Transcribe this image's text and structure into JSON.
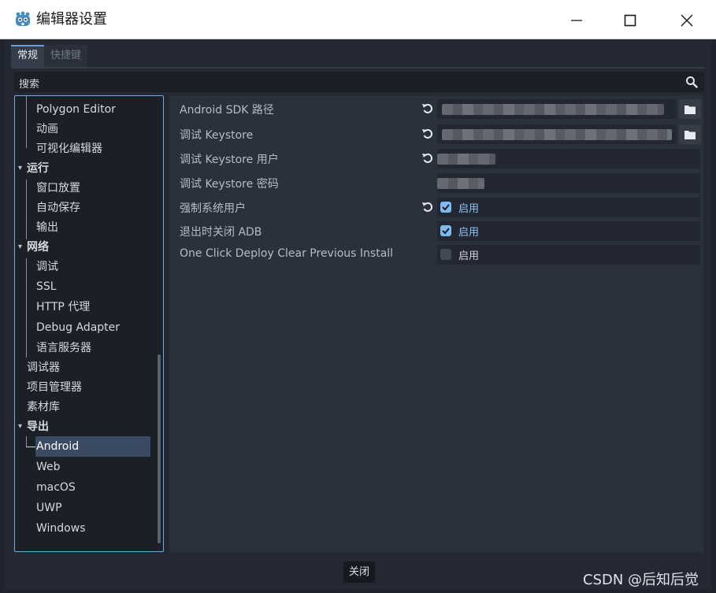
{
  "window": {
    "title": "编辑器设置",
    "icon": "godot-icon",
    "controls": [
      "minimize-icon",
      "maximize-icon",
      "close-icon"
    ]
  },
  "tabs": [
    {
      "label": "常规",
      "active": true
    },
    {
      "label": "快捷键",
      "active": false
    }
  ],
  "search": {
    "placeholder": "搜索",
    "icon": "search-icon"
  },
  "tree": {
    "items": [
      {
        "label": "Polygon Editor",
        "type": "item"
      },
      {
        "label": "动画",
        "type": "item"
      },
      {
        "label": "可视化编辑器",
        "type": "item"
      },
      {
        "label": "运行",
        "type": "category"
      },
      {
        "label": "窗口放置",
        "type": "item"
      },
      {
        "label": "自动保存",
        "type": "item"
      },
      {
        "label": "输出",
        "type": "item"
      },
      {
        "label": "网络",
        "type": "category"
      },
      {
        "label": "调试",
        "type": "item"
      },
      {
        "label": "SSL",
        "type": "item"
      },
      {
        "label": "HTTP 代理",
        "type": "item"
      },
      {
        "label": "Debug Adapter",
        "type": "item"
      },
      {
        "label": "语言服务器",
        "type": "item"
      },
      {
        "label": "调试器",
        "type": "top"
      },
      {
        "label": "项目管理器",
        "type": "top"
      },
      {
        "label": "素材库",
        "type": "top"
      },
      {
        "label": "导出",
        "type": "category"
      },
      {
        "label": "Android",
        "type": "item",
        "selected": true
      },
      {
        "label": "Web",
        "type": "item"
      },
      {
        "label": "macOS",
        "type": "item"
      },
      {
        "label": "UWP",
        "type": "item"
      },
      {
        "label": "Windows",
        "type": "item"
      }
    ]
  },
  "settings": [
    {
      "label": "Android SDK 路径",
      "kind": "path",
      "revert": true
    },
    {
      "label": "调试 Keystore",
      "kind": "path",
      "revert": true
    },
    {
      "label": "调试 Keystore 用户",
      "kind": "text",
      "revert": true
    },
    {
      "label": "调试 Keystore 密码",
      "kind": "text",
      "revert": false
    },
    {
      "label": "强制系统用户",
      "kind": "bool",
      "checked": true,
      "value_label": "启用",
      "revert": true
    },
    {
      "label": "退出时关闭 ADB",
      "kind": "bool",
      "checked": true,
      "value_label": "启用",
      "revert": false
    },
    {
      "label": "One Click Deploy Clear Previous Install",
      "kind": "bool",
      "checked": false,
      "value_label": "启用",
      "revert": false
    }
  ],
  "footer": {
    "close_label": "关闭"
  },
  "watermark": "CSDN @后知后觉",
  "colors": {
    "accent": "#6aaee8",
    "checkbox_on": "#7eb9f0",
    "selection": "#3a4a63"
  }
}
